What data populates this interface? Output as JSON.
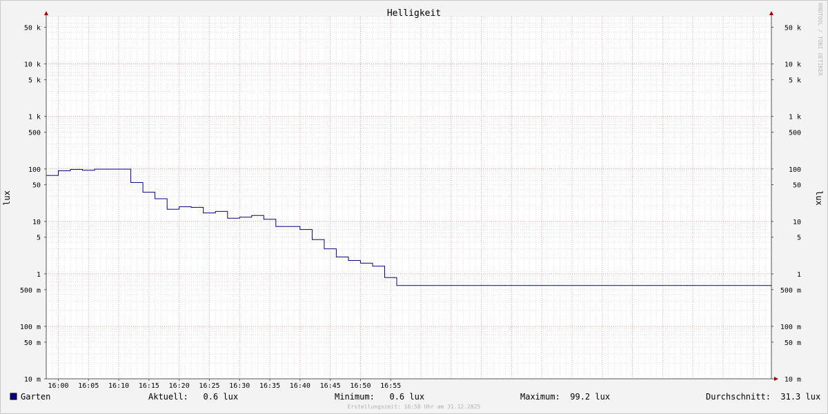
{
  "chart_data": {
    "type": "line",
    "title": "Helligkeit",
    "ylabel": "lux",
    "scale": "log",
    "ylim": [
      0.01,
      80000
    ],
    "xlim": [
      "15:58",
      "17:58"
    ],
    "grid": true,
    "x_ticks": [
      "16:00",
      "16:05",
      "16:10",
      "16:15",
      "16:20",
      "16:25",
      "16:30",
      "16:35",
      "16:40",
      "16:45",
      "16:50",
      "16:55"
    ],
    "y_ticks": [
      {
        "value": 50000,
        "label": "50 k"
      },
      {
        "value": 10000,
        "label": "10 k"
      },
      {
        "value": 5000,
        "label": "5 k"
      },
      {
        "value": 1000,
        "label": "1 k"
      },
      {
        "value": 500,
        "label": "500"
      },
      {
        "value": 100,
        "label": "100"
      },
      {
        "value": 50,
        "label": "50"
      },
      {
        "value": 10,
        "label": "10"
      },
      {
        "value": 5,
        "label": "5"
      },
      {
        "value": 1,
        "label": "1"
      },
      {
        "value": 0.5,
        "label": "500 m"
      },
      {
        "value": 0.1,
        "label": "100 m"
      },
      {
        "value": 0.05,
        "label": "50 m"
      },
      {
        "value": 0.01,
        "label": "10 m"
      }
    ],
    "series": [
      {
        "name": "Garten",
        "color": "#00008b",
        "points": [
          {
            "x": "15:58",
            "y": 75
          },
          {
            "x": "16:00",
            "y": 92
          },
          {
            "x": "16:02",
            "y": 98
          },
          {
            "x": "16:04",
            "y": 94
          },
          {
            "x": "16:06",
            "y": 99
          },
          {
            "x": "16:08",
            "y": 99
          },
          {
            "x": "16:10",
            "y": 99
          },
          {
            "x": "16:12",
            "y": 55
          },
          {
            "x": "16:14",
            "y": 36
          },
          {
            "x": "16:16",
            "y": 27
          },
          {
            "x": "16:18",
            "y": 17
          },
          {
            "x": "16:20",
            "y": 19
          },
          {
            "x": "16:22",
            "y": 18.5
          },
          {
            "x": "16:24",
            "y": 14.5
          },
          {
            "x": "16:26",
            "y": 15.5
          },
          {
            "x": "16:28",
            "y": 11.5
          },
          {
            "x": "16:30",
            "y": 12
          },
          {
            "x": "16:32",
            "y": 13
          },
          {
            "x": "16:34",
            "y": 11
          },
          {
            "x": "16:36",
            "y": 8
          },
          {
            "x": "16:38",
            "y": 8
          },
          {
            "x": "16:40",
            "y": 7
          },
          {
            "x": "16:42",
            "y": 4.5
          },
          {
            "x": "16:44",
            "y": 3
          },
          {
            "x": "16:46",
            "y": 2.1
          },
          {
            "x": "16:48",
            "y": 1.8
          },
          {
            "x": "16:50",
            "y": 1.6
          },
          {
            "x": "16:52",
            "y": 1.4
          },
          {
            "x": "16:54",
            "y": 0.85
          },
          {
            "x": "16:56",
            "y": 0.6
          }
        ]
      }
    ]
  },
  "legend": {
    "series_name": "Garten",
    "swatch_color": "#00008b",
    "current": "Aktuell:   0.6 lux",
    "minimum": "Minimum:   0.6 lux",
    "maximum": "Maximum:  99.2 lux",
    "average": "Durchschnitt:  31.3 lux"
  },
  "footer": "Erstellungszeit: 16:58 Uhr am 31.12.2025",
  "watermark": "RRDTOOL / TOBI OETIKER"
}
